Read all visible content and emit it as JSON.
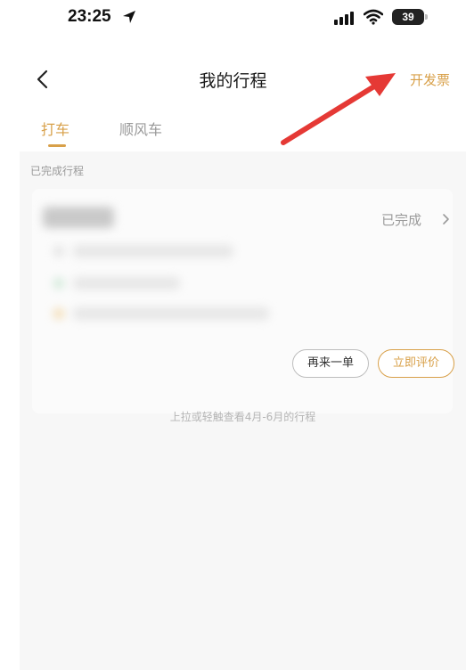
{
  "status_bar": {
    "time": "23:25",
    "battery": "39",
    "icons": [
      "location-arrow-icon",
      "signal-icon",
      "wifi-icon",
      "battery-icon"
    ]
  },
  "header": {
    "title": "我的行程",
    "invoice_label": "开发票",
    "back_icon": "chevron-left-icon"
  },
  "tabs": [
    {
      "label": "打车",
      "active": true
    },
    {
      "label": "顺风车",
      "active": false
    }
  ],
  "section_label": "已完成行程",
  "trip": {
    "status": "已完成",
    "status_icon": "chevron-right-icon",
    "again_button": "再来一单",
    "rate_button": "立即评价"
  },
  "hint_text": "上拉或轻触查看4月-6月的行程",
  "colors": {
    "accent": "#d8a049",
    "annotation_arrow": "#e53935",
    "panel_bg": "#f7f7f7"
  }
}
